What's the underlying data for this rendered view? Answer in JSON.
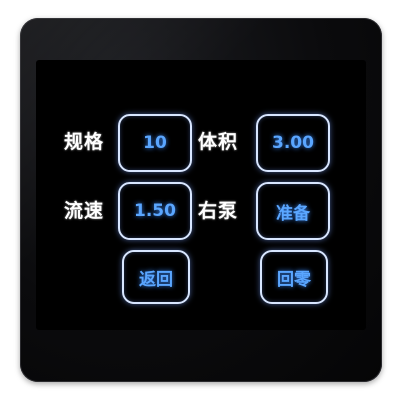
{
  "panel": {
    "rows": [
      {
        "left_label": "规格",
        "left_value": "10",
        "right_label": "体积",
        "right_value": "3.00"
      },
      {
        "left_label": "流速",
        "left_value": "1.50",
        "right_label": "右泵",
        "right_value": "准备"
      }
    ],
    "back_button": "返回",
    "zero_button": "回零"
  },
  "colors": {
    "button_text": "#5aa6ff",
    "button_border": "#d8e6ff",
    "label_text": "#ffffff",
    "screen_background": "#000000"
  }
}
